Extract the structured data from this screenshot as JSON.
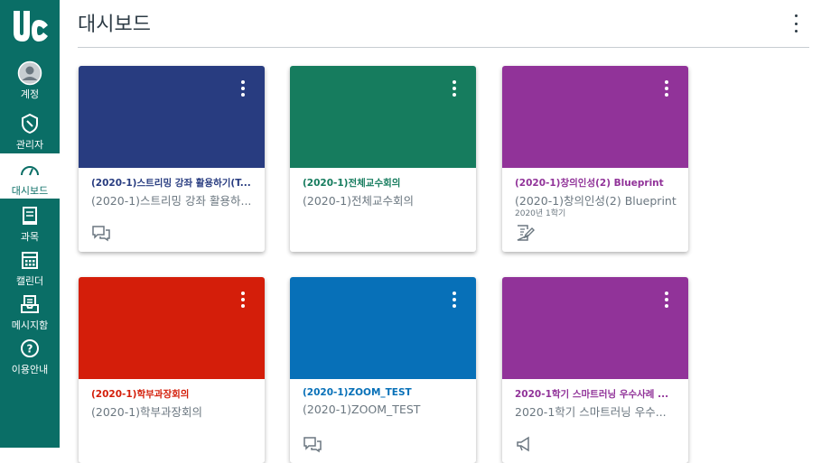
{
  "sidebar": {
    "logo_label": "UC",
    "items": [
      {
        "label": "계정",
        "icon": "account-icon"
      },
      {
        "label": "관리자",
        "icon": "admin-icon"
      },
      {
        "label": "대시보드",
        "icon": "dashboard-icon"
      },
      {
        "label": "과목",
        "icon": "courses-icon"
      },
      {
        "label": "캘린더",
        "icon": "calendar-icon"
      },
      {
        "label": "메시지함",
        "icon": "inbox-icon"
      },
      {
        "label": "이용안내",
        "icon": "help-icon"
      }
    ],
    "active_index": 2
  },
  "header": {
    "title": "대시보드"
  },
  "colors": {
    "sidebar": "#0a6e66",
    "accent_text": "#2d3b45"
  },
  "cards": [
    {
      "title": "(2020-1)스트리밍 강좌 활용하기(T...",
      "subtitle": "(2020-1)스트리밍 강좌 활용하...",
      "term": "",
      "color": "#283c80",
      "action_icon": "discussion-icon"
    },
    {
      "title": "(2020-1)전체교수회의",
      "subtitle": "(2020-1)전체교수회의",
      "term": "",
      "color": "#167c5e",
      "action_icon": ""
    },
    {
      "title": "(2020-1)창의인성(2) Blueprint",
      "subtitle": "(2020-1)창의인성(2) Blueprint",
      "term": "2020년 1학기",
      "color": "#913399",
      "action_icon": "assignment-icon"
    },
    {
      "title": "(2020-1)학부과장회의",
      "subtitle": "(2020-1)학부과장회의",
      "term": "",
      "color": "#d41e0a",
      "action_icon": ""
    },
    {
      "title": "(2020-1)ZOOM_TEST",
      "subtitle": "(2020-1)ZOOM_TEST",
      "term": "",
      "color": "#0770b8",
      "action_icon": "discussion-icon"
    },
    {
      "title": "2020-1학기 스마트러닝 우수사례 ...",
      "subtitle": "2020-1학기 스마트러닝 우수...",
      "term": "",
      "color": "#913399",
      "action_icon": "announcement-icon"
    }
  ]
}
